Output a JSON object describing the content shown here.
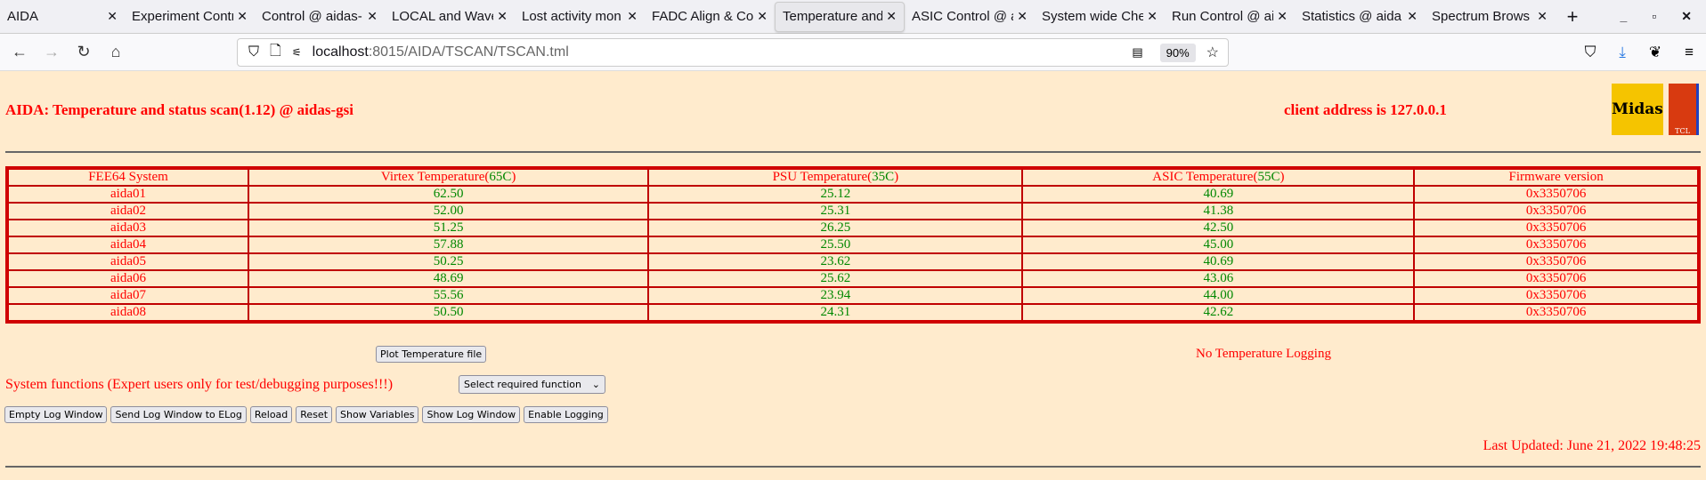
{
  "browser": {
    "tabs": [
      {
        "label": "AIDA"
      },
      {
        "label": "Experiment Contr"
      },
      {
        "label": "Control @ aidas-"
      },
      {
        "label": "LOCAL and Wave"
      },
      {
        "label": "Lost activity mon"
      },
      {
        "label": "FADC Align & Co"
      },
      {
        "label": "Temperature and"
      },
      {
        "label": "ASIC Control @ a"
      },
      {
        "label": "System wide Che"
      },
      {
        "label": "Run Control @ ai"
      },
      {
        "label": "Statistics @ aida"
      },
      {
        "label": "Spectrum Brows"
      }
    ],
    "url_host": "localhost",
    "url_rest": ":8015/AIDA/TSCAN/TSCAN.tml",
    "zoom": "90%"
  },
  "page": {
    "title": "AIDA: Temperature and status scan(1.12) @ aidas-gsi",
    "client": "client address is 127.0.0.1",
    "logo_midas": "Midas",
    "logo_tcl": "TCL POWERED",
    "headers": {
      "system": "FEE64 System",
      "virtex": "Virtex Temperature(",
      "virtex_limit": "65C",
      "psu": "PSU Temperature(",
      "psu_limit": "35C",
      "asic": "ASIC Temperature(",
      "asic_limit": "55C",
      "fw": "Firmware version",
      "close": ")"
    },
    "rows": [
      {
        "name": "aida01",
        "virtex": "62.50",
        "psu": "25.12",
        "asic": "40.69",
        "fw": "0x3350706"
      },
      {
        "name": "aida02",
        "virtex": "52.00",
        "psu": "25.31",
        "asic": "41.38",
        "fw": "0x3350706"
      },
      {
        "name": "aida03",
        "virtex": "51.25",
        "psu": "26.25",
        "asic": "42.50",
        "fw": "0x3350706"
      },
      {
        "name": "aida04",
        "virtex": "57.88",
        "psu": "25.50",
        "asic": "45.00",
        "fw": "0x3350706"
      },
      {
        "name": "aida05",
        "virtex": "50.25",
        "psu": "23.62",
        "asic": "40.69",
        "fw": "0x3350706"
      },
      {
        "name": "aida06",
        "virtex": "48.69",
        "psu": "25.62",
        "asic": "43.06",
        "fw": "0x3350706"
      },
      {
        "name": "aida07",
        "virtex": "55.56",
        "psu": "23.94",
        "asic": "44.00",
        "fw": "0x3350706"
      },
      {
        "name": "aida08",
        "virtex": "50.50",
        "psu": "24.31",
        "asic": "42.62",
        "fw": "0x3350706"
      }
    ],
    "plot_button": "Plot Temperature file",
    "logging_status": "No Temperature Logging",
    "system_functions": "System functions (Expert users only for test/debugging purposes!!!)",
    "select_value": "Select required function",
    "buttons": [
      "Empty Log Window",
      "Send Log Window to ELog",
      "Reload",
      "Reset",
      "Show Variables",
      "Show Log Window",
      "Enable Logging"
    ],
    "last_updated": "Last Updated: June 21, 2022 19:48:25"
  }
}
